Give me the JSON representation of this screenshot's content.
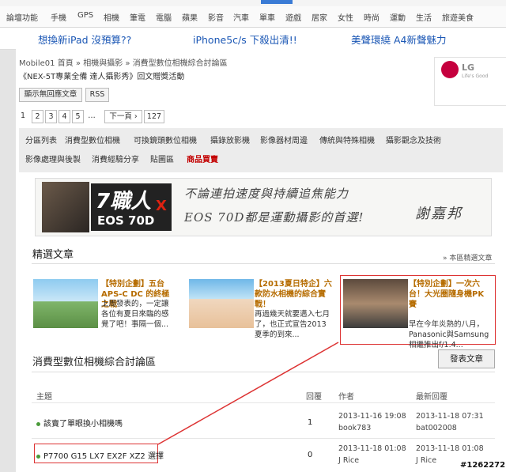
{
  "nav": [
    "論壇功能",
    "手機",
    "GPS",
    "相機",
    "筆電",
    "電腦",
    "蘋果",
    "影音",
    "汽車",
    "單車",
    "遊戲",
    "居家",
    "女性",
    "時尚",
    "運動",
    "生活",
    "旅遊美食"
  ],
  "promos": [
    "想換新iPad 沒預算??",
    "iPhone5c/s 下殺出清!!",
    "美聲環繞 A4新聲魅力"
  ],
  "breadcrumb": {
    "site": "Mobile01 首頁",
    "sep1": " » ",
    "cat": "相機與攝影",
    "sep2": " » ",
    "forum": "消費型數位相機綜合討論區"
  },
  "subtitle": "《NEX-5T專業全備 達人攝影秀》回文贈獎活動",
  "buttons": {
    "unread": "顯示無回應文章",
    "rss": "RSS",
    "prev": "← ",
    "next": "下一頁 ›",
    "post": "發表文章"
  },
  "pages": [
    "1",
    "2",
    "3",
    "4",
    "5",
    "…",
    "127"
  ],
  "ad": {
    "brand": "LG",
    "tagline": "Life's Good"
  },
  "categories": {
    "row1": [
      "分區列表",
      "消費型數位相機",
      "可換鏡頭數位相機",
      "攝錄放影機",
      "影像器材周邊",
      "傳統與特殊相機",
      "攝影觀念及技術"
    ],
    "row2": [
      "影像處理與後製",
      "消費經驗分享",
      "貼圖區",
      "商品買賣"
    ]
  },
  "banner": {
    "logo": "7職人",
    "x": "X",
    "model": "EOS 70D",
    "line1": "不論連拍速度與持續追焦能力",
    "line2": "EOS 70D都是運動攝影的首選!",
    "signature": "謝嘉邦"
  },
  "featured": {
    "title": "精選文章",
    "more": "» 本區精選文章",
    "items": [
      {
        "title_hl": "【特別企劃】五台APS-C DC 的終極之戰",
        "desc": "上周發表的，一定讓各位有夏日來臨的感覺了吧！事隔一個..."
      },
      {
        "title_hl": "【2013夏日特企】六款防水相機的綜合實戰！",
        "desc": "再過幾天就要邁入七月了，也正式宣告2013夏季的到來..."
      },
      {
        "title_hl": "【特別企劃】一次六台！大光圈隨身機PK賽",
        "desc": "早在今年炎熱的八月，Panasonic與Samsung相繼推出f/1.4..."
      }
    ]
  },
  "forum_title": "消費型數位相機綜合討論區",
  "table": {
    "headers": [
      "主題",
      "回覆",
      "作者",
      "最新回覆"
    ],
    "rows": [
      {
        "topic": "該賣了單眼換小相機嗎",
        "replies": "1",
        "author_date": "2013-11-16 19:08",
        "author": "book783",
        "last_date": "2013-11-18 07:31",
        "last_user": "bat002008"
      },
      {
        "topic": "P7700 G15 LX7 EX2F XZ2 選擇",
        "replies": "0",
        "author_date": "2013-11-18 01:08",
        "author": "J Rice",
        "last_date": "2013-11-18 01:08",
        "last_user": "J Rice"
      }
    ]
  },
  "watermark": "#1262272"
}
